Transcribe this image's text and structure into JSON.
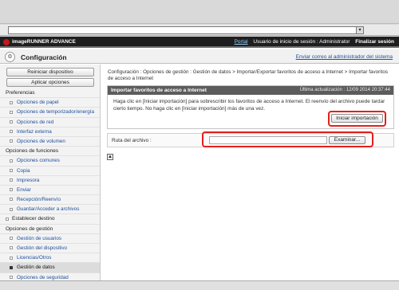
{
  "header": {
    "product": "imageRUNNER ADVANCE",
    "portal": "Portal",
    "session_label": "Usuario de inicio de sesión : Administrator",
    "logout": "Finalizar sesión"
  },
  "title": {
    "icon": "settings-icon",
    "text": "Configuración",
    "admin_mail": "Enviar correo al administrador del sistema"
  },
  "sidebar": {
    "restart_button": "Reiniciar dispositivo",
    "apply_button": "Aplicar opciones",
    "sections": [
      {
        "label": "Preferencias",
        "items": [
          "Opciones de papel",
          "Opciones de temporizador/energía",
          "Opciones de red",
          "Interfaz externa",
          "Opciones de volumen"
        ]
      },
      {
        "label": "Opciones de funciones",
        "items": [
          "Opciones comunes",
          "Copia",
          "Impresora",
          "Enviar",
          "Recepción/Reenvío",
          "Guardar/Acceder a archivos"
        ]
      },
      {
        "label": "Establecer destino",
        "items": []
      },
      {
        "label": "Opciones de gestión",
        "items": [
          "Gestión de usuarios",
          "Gestión del dispositivo",
          "Licencias/Otros",
          "Gestión de datos",
          "Opciones de seguridad"
        ]
      }
    ]
  },
  "main": {
    "breadcrumb": "Configuración : Opciones de gestión : Gestión de datos > Importar/Exportar favoritos de acceso a Internet > Importar favoritos de acceso a Internet",
    "panel_title": "Importar favoritos de acceso a Internet",
    "last_updated": "Última actualización : 12/09 2014 20:37:44",
    "description": "Haga clic en [Iniciar importación] para sobrescribir los favoritos de acceso a Internet. El reenvío del archivo puede tardar cierto tiempo. No haga clic en [Iniciar importación] más de una vez.",
    "import_button": "Iniciar importación",
    "file_path_label": "Ruta del archivo :",
    "file_path_value": "",
    "browse_button": "Examinar..."
  },
  "colors": {
    "header_bg": "#1e1e1e",
    "panel_head_bg": "#5c5c5c",
    "highlight": "#e2201c",
    "link": "#1e4e9c"
  }
}
